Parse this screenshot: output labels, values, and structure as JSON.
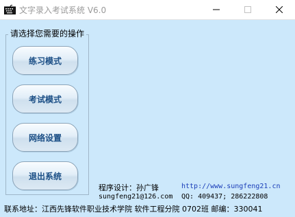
{
  "window": {
    "title": "文字录入考试系统 V6.0",
    "controls": {
      "minimize": "minimize-icon",
      "maximize": "maximize-icon",
      "close": "close-icon"
    }
  },
  "group": {
    "title": "请选择您需要的操作",
    "buttons": [
      "练习模式",
      "考试模式",
      "网络设置",
      "退出系统"
    ]
  },
  "info": {
    "designer": "程序设计：孙广锋",
    "website": "http://www.sungfeng21.cn",
    "email": "sungfeng21@126.com",
    "qq": "QQ: 409437; 286222808"
  },
  "footer": {
    "address": "联系地址：江西先锋软件职业技术学院 软件工程分院 0702班  邮编：330041"
  },
  "colors": {
    "background": "#cce8fb",
    "button_text": "#1c4f86",
    "link": "#1a3db8"
  }
}
